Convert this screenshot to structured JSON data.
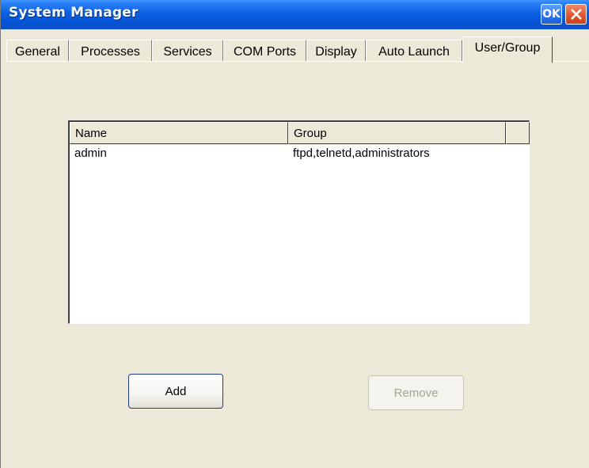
{
  "window": {
    "title": "System Manager",
    "ok_label": "OK"
  },
  "tabs": [
    {
      "label": "General"
    },
    {
      "label": "Processes"
    },
    {
      "label": "Services"
    },
    {
      "label": "COM Ports"
    },
    {
      "label": "Display"
    },
    {
      "label": "Auto Launch"
    },
    {
      "label": "User/Group",
      "active": true
    }
  ],
  "user_list": {
    "columns": [
      "Name",
      "Group"
    ],
    "rows": [
      {
        "name": "admin",
        "group": "ftpd,telnetd,administrators"
      }
    ]
  },
  "buttons": {
    "add_label": "Add",
    "remove_label": "Remove",
    "remove_enabled": false
  },
  "colors": {
    "titlebar": "#0a5fe0",
    "window_bg": "#ece9d8",
    "close_button": "#e35a36",
    "disabled_text": "#a6a592"
  }
}
